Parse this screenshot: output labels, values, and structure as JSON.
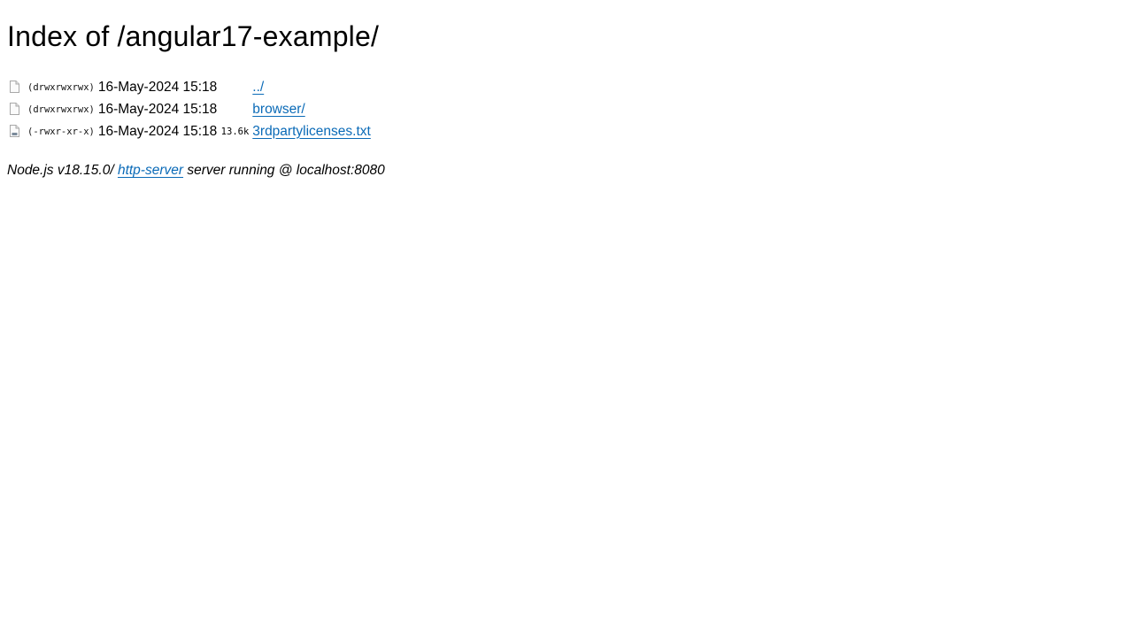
{
  "title": "Index of /angular17-example/",
  "rows": [
    {
      "icon": "folder-icon",
      "perms": "(drwxrwxrwx)",
      "date": "16-May-2024 15:18",
      "size": "",
      "name": "../"
    },
    {
      "icon": "folder-icon",
      "perms": "(drwxrwxrwx)",
      "date": "16-May-2024 15:18",
      "size": "",
      "name": "browser/"
    },
    {
      "icon": "text-file-icon",
      "perms": "(-rwxr-xr-x)",
      "date": "16-May-2024 15:18",
      "size": "13.6k",
      "name": "3rdpartylicenses.txt"
    }
  ],
  "footer": {
    "prefix": "Node.js v18.15.0/ ",
    "link": "http-server",
    "suffix": " server running @ localhost:8080"
  },
  "colors": {
    "link": "#0a6ab7",
    "text": "#000000",
    "background": "#ffffff"
  }
}
